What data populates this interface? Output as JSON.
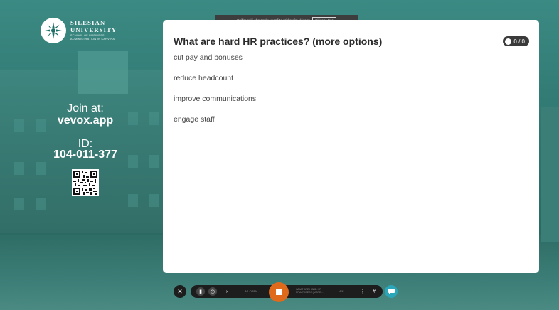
{
  "brand": {
    "line1": "SILESIAN",
    "line2": "UNIVERSITY",
    "line3": "SCHOOL OF BUSINESS",
    "line4": "ADMINISTRATION IN KARVINA"
  },
  "join": {
    "label": "Join at:",
    "url": "vevox.app",
    "id_label": "ID:",
    "id_value": "104-011-377"
  },
  "fullscreen_notice": {
    "text": "Režim celé obrazovky ukončíte stisknutím klávesy",
    "key": "Klávesa Esc"
  },
  "question": {
    "title": "What are hard HR practices? (more options)",
    "response_count": "0 / 0",
    "options": [
      "cut pay and bonuses",
      "reduce headcount",
      "improve communications",
      "engage staff"
    ]
  },
  "toolbar": {
    "close_icon": "close-icon",
    "status_text": "3/1 OPEN",
    "current_question": "WHAT ARE HARD HR PRACTICES? (MORE...",
    "page_indicator": "4/4",
    "colors": {
      "stop": "#e06a1c",
      "chat": "#2aa6b8",
      "bar": "#1d1d1d"
    }
  }
}
